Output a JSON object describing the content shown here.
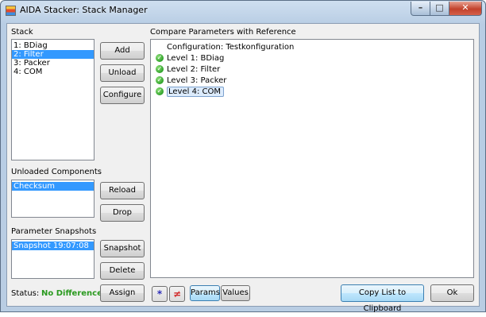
{
  "window": {
    "title": "AIDA Stacker: Stack Manager",
    "app_icon": "stack-app-icon"
  },
  "window_controls": {
    "minimize": "–",
    "maximize": "□",
    "close": "✕"
  },
  "stack": {
    "label": "Stack",
    "items": [
      "1: BDiag",
      "2: Filter",
      "3: Packer",
      "4: COM"
    ],
    "selected_index": 1,
    "buttons": {
      "add": "Add",
      "unload": "Unload",
      "configure": "Configure"
    }
  },
  "unloaded": {
    "label": "Unloaded  Components",
    "items": [
      "Checksum"
    ],
    "buttons": {
      "reload": "Reload",
      "drop": "Drop"
    }
  },
  "snapshots": {
    "label": "Parameter Snapshots",
    "items": [
      "Snapshot 19:07:08"
    ],
    "buttons": {
      "snapshot": "Snapshot",
      "delete": "Delete"
    }
  },
  "compare": {
    "label": "Compare Parameters with Reference",
    "root": "Configuration: Testkonfiguration",
    "levels": [
      "Level 1: BDiag",
      "Level 2: Filter",
      "Level 3: Packer",
      "Level 4: COM"
    ],
    "selected_index": 3
  },
  "status": {
    "label": "Status:",
    "value": "No Differences",
    "value_color": "#2a9a1f"
  },
  "bottom": {
    "assign": "Assign",
    "star_icon": "*",
    "diff_icon": "≠",
    "params": "Params",
    "values": "Values",
    "copy": "Copy List to Clipboard",
    "ok": "Ok"
  }
}
